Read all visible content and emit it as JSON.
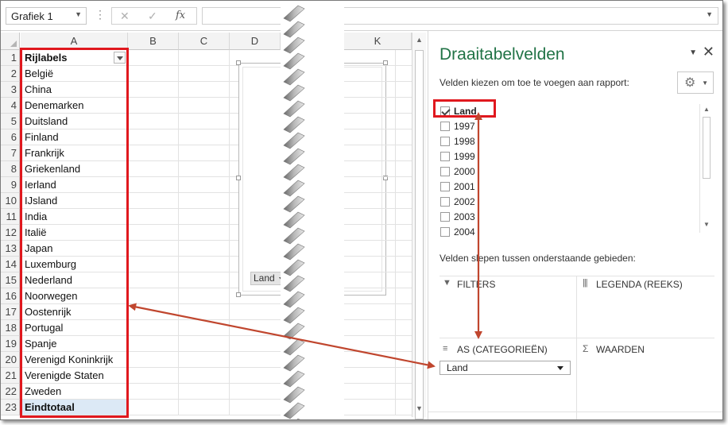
{
  "formula_bar": {
    "name_box": "Grafiek 1",
    "cancel_icon": "✕",
    "enter_icon": "✓",
    "fx_label": "fx",
    "formula_value": ""
  },
  "sheet": {
    "columns_left": [
      "A",
      "B",
      "C",
      "D"
    ],
    "columns_right": [
      "K"
    ],
    "row_numbers": [
      "1",
      "2",
      "3",
      "4",
      "5",
      "6",
      "7",
      "8",
      "9",
      "10",
      "11",
      "12",
      "13",
      "14",
      "15",
      "16",
      "17",
      "18",
      "19",
      "20",
      "21",
      "22",
      "23"
    ],
    "column_a": [
      "Rijlabels",
      "België",
      "China",
      "Denemarken",
      "Duitsland",
      "Finland",
      "Frankrijk",
      "Griekenland",
      "Ierland",
      "IJsland",
      "India",
      "Italië",
      "Japan",
      "Luxemburg",
      "Nederland",
      "Noorwegen",
      "Oostenrijk",
      "Portugal",
      "Spanje",
      "Verenigd Koninkrijk",
      "Verenigde Staten",
      "Zweden",
      "Eindtotaal"
    ]
  },
  "chart": {
    "field_button": "Land"
  },
  "pivot_pane": {
    "title": "Draaitabelvelden",
    "choose_fields_label": "Velden kiezen om toe te voegen aan rapport:",
    "fields": [
      {
        "label": "Land",
        "checked": true
      },
      {
        "label": "1997",
        "checked": false
      },
      {
        "label": "1998",
        "checked": false
      },
      {
        "label": "1999",
        "checked": false
      },
      {
        "label": "2000",
        "checked": false
      },
      {
        "label": "2001",
        "checked": false
      },
      {
        "label": "2002",
        "checked": false
      },
      {
        "label": "2003",
        "checked": false
      },
      {
        "label": "2004",
        "checked": false
      }
    ],
    "drag_label": "Velden slepen tussen onderstaande gebieden:",
    "areas": {
      "filters": "FILTERS",
      "legend": "LEGENDA (REEKS)",
      "axis": "AS (CATEGORIEËN)",
      "values": "WAARDEN",
      "axis_item": "Land"
    }
  },
  "colors": {
    "highlight_box": "#e0181e",
    "arrow": "#c0462e",
    "pane_title": "#217346",
    "total_row": "#dce9f6"
  }
}
